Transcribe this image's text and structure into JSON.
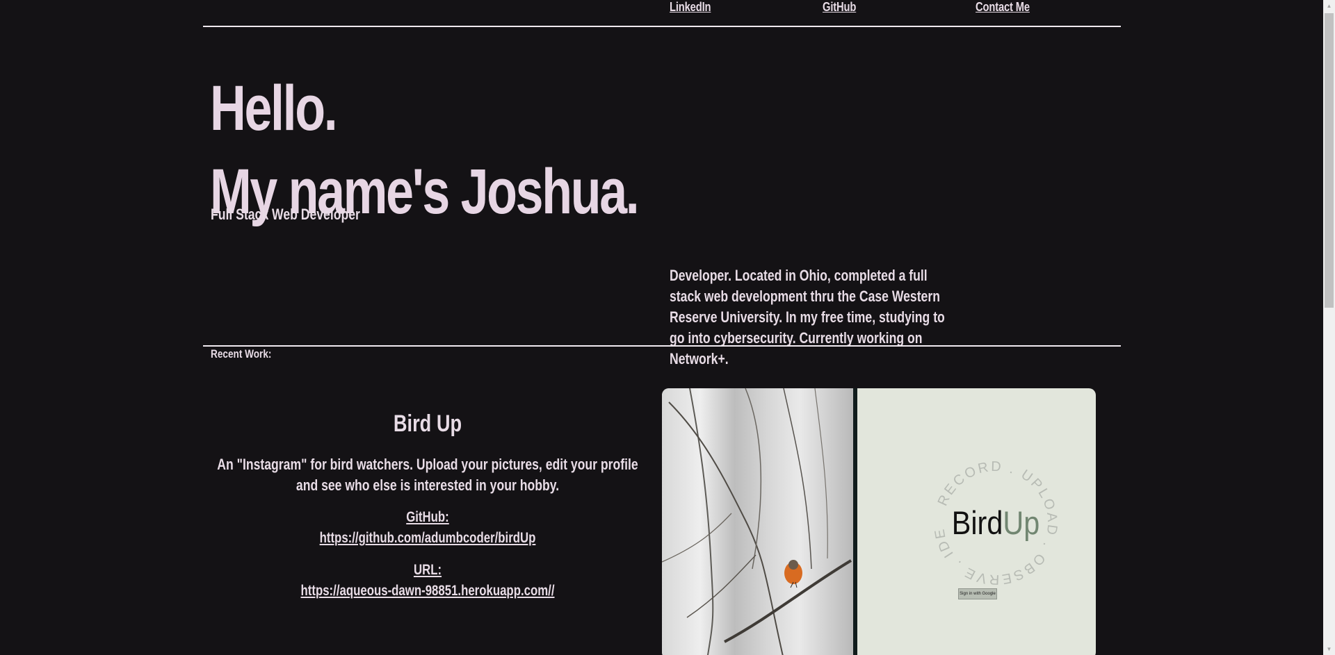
{
  "nav": {
    "linkedin": "LinkedIn",
    "github": "GitHub",
    "contact": "Contact Me"
  },
  "hero": {
    "greeting": "Hello.",
    "name": "My name's Joshua.",
    "subtitle": "Full Stack Web Developer",
    "about": "Developer. Located in Ohio, completed a full stack web development thru the Case Western Reserve University. In my free time, studying to go into cybersecurity. Currently working on Network+."
  },
  "recent_work": {
    "heading": "Recent Work:",
    "project": {
      "title": "Bird Up",
      "description": "An \"Instagram\" for bird watchers. Upload your pictures, edit your profile and see who else is interested in your hobby.",
      "github_label": "GitHub:",
      "github_url": "https://github.com/adumbcoder/birdUp",
      "url_label": "URL:",
      "url": "https://aqueous-dawn-98851.herokuapp.com//"
    }
  },
  "preview": {
    "brand_dark": "Bird",
    "brand_accent": "Up",
    "circle_text": "RECORD . UPLOAD . OBSERVE . IDENTIFY .",
    "signin": "Sign in with Google"
  },
  "colors": {
    "background": "#141215",
    "text": "#e8dce6",
    "accent": "#718671"
  }
}
